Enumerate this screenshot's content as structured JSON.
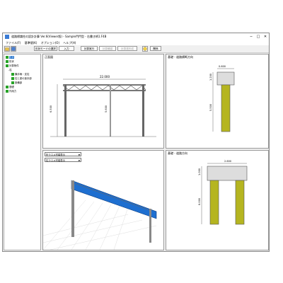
{
  "window": {
    "title": "道路標識柱の設計計算 Ver.6(Viewer版) - Sample門門型 - 右書き柄1.F4B",
    "minimize": "─",
    "maximize": "□",
    "close": "✕"
  },
  "menu": [
    "ファイル(F)",
    "基準値(K)",
    "オプション(O)",
    "ヘルプ(H)"
  ],
  "toolbar": {
    "mode_select": "形状モードの選択",
    "input": "入力",
    "calc": "計算実行",
    "calc_confirm": "計算確認",
    "report": "計算書作成",
    "about": "関係"
  },
  "tree": [
    {
      "label": "形状",
      "level": 0,
      "selected": true
    },
    {
      "label": "形状",
      "level": 0,
      "selected": false
    },
    {
      "label": "計算条件",
      "level": 0,
      "selected": false
    },
    {
      "label": "-柱",
      "level": 1,
      "selected": false
    },
    {
      "label": "横手柄・支柱",
      "level": 2,
      "selected": false
    },
    {
      "label": "柱と梁の接手部",
      "level": 2,
      "selected": false
    },
    {
      "label": "設備部",
      "level": 2,
      "selected": false
    },
    {
      "label": "基礎",
      "level": 0,
      "selected": false
    },
    {
      "label": "作用力",
      "level": 0,
      "selected": false
    }
  ],
  "panes": {
    "front": {
      "title": "正面図",
      "span_label": "22.000",
      "height_label": "6.500",
      "mid_label": "5.600"
    },
    "base_cross": {
      "title": "基礎 - 道路横断方向",
      "top_dim": "0.600",
      "top_height": "1.200",
      "pile_height": "5.500"
    },
    "view3d": {
      "dropdown1": "桁ラスメ材端表示",
      "dropdown2": "柱ラスメ材端表示"
    },
    "base_long": {
      "title": "基礎 - 道路方向",
      "top_dim": "2.600",
      "top_height": "1.000",
      "pile_height": "6.000"
    }
  },
  "colors": {
    "accent": "#0a64c8",
    "pile": "#b5b520",
    "sign": "#1e6fd0",
    "node": "#27a327"
  }
}
